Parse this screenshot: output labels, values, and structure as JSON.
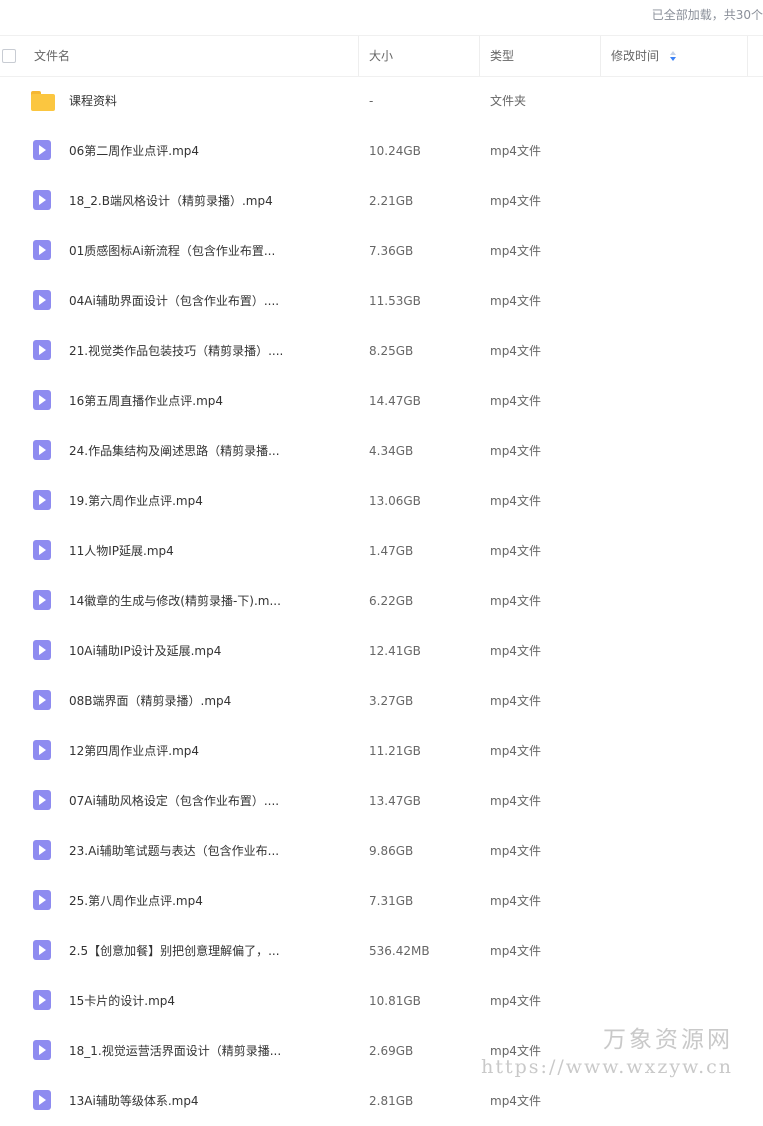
{
  "status": "已全部加载，共30个",
  "header": {
    "name": "文件名",
    "size": "大小",
    "type": "类型",
    "mtime": "修改时间"
  },
  "rows": [
    {
      "icon": "folder-icon",
      "name": "课程资料",
      "size": "-",
      "type": "文件夹"
    },
    {
      "icon": "video-icon",
      "name": "06第二周作业点评.mp4",
      "size": "10.24GB",
      "type": "mp4文件"
    },
    {
      "icon": "video-icon",
      "name": "18_2.B端风格设计（精剪录播）.mp4",
      "size": "2.21GB",
      "type": "mp4文件"
    },
    {
      "icon": "video-icon",
      "name": "01质感图标Ai新流程（包含作业布置...",
      "size": "7.36GB",
      "type": "mp4文件"
    },
    {
      "icon": "video-icon",
      "name": "04Ai辅助界面设计（包含作业布置）....",
      "size": "11.53GB",
      "type": "mp4文件"
    },
    {
      "icon": "video-icon",
      "name": "21.视觉类作品包装技巧（精剪录播）....",
      "size": "8.25GB",
      "type": "mp4文件"
    },
    {
      "icon": "video-icon",
      "name": "16第五周直播作业点评.mp4",
      "size": "14.47GB",
      "type": "mp4文件"
    },
    {
      "icon": "video-icon",
      "name": "24.作品集结构及阐述思路（精剪录播...",
      "size": "4.34GB",
      "type": "mp4文件"
    },
    {
      "icon": "video-icon",
      "name": "19.第六周作业点评.mp4",
      "size": "13.06GB",
      "type": "mp4文件"
    },
    {
      "icon": "video-icon",
      "name": "11人物IP延展.mp4",
      "size": "1.47GB",
      "type": "mp4文件"
    },
    {
      "icon": "video-icon",
      "name": "14徽章的生成与修改(精剪录播-下).m...",
      "size": "6.22GB",
      "type": "mp4文件"
    },
    {
      "icon": "video-icon",
      "name": "10Ai辅助IP设计及延展.mp4",
      "size": "12.41GB",
      "type": "mp4文件"
    },
    {
      "icon": "video-icon",
      "name": "08B端界面（精剪录播）.mp4",
      "size": "3.27GB",
      "type": "mp4文件"
    },
    {
      "icon": "video-icon",
      "name": "12第四周作业点评.mp4",
      "size": "11.21GB",
      "type": "mp4文件"
    },
    {
      "icon": "video-icon",
      "name": "07Ai辅助风格设定（包含作业布置）....",
      "size": "13.47GB",
      "type": "mp4文件"
    },
    {
      "icon": "video-icon",
      "name": "23.Ai辅助笔试题与表达（包含作业布...",
      "size": "9.86GB",
      "type": "mp4文件"
    },
    {
      "icon": "video-icon",
      "name": "25.第八周作业点评.mp4",
      "size": "7.31GB",
      "type": "mp4文件"
    },
    {
      "icon": "video-icon",
      "name": "2.5【创意加餐】别把创意理解偏了，...",
      "size": "536.42MB",
      "type": "mp4文件"
    },
    {
      "icon": "video-icon",
      "name": "15卡片的设计.mp4",
      "size": "10.81GB",
      "type": "mp4文件"
    },
    {
      "icon": "video-icon",
      "name": "18_1.视觉运营活界面设计（精剪录播...",
      "size": "2.69GB",
      "type": "mp4文件"
    },
    {
      "icon": "video-icon",
      "name": "13Ai辅助等级体系.mp4",
      "size": "2.81GB",
      "type": "mp4文件"
    }
  ],
  "watermark": {
    "line1": "万象资源网",
    "line2": "https://www.wxzyw.cn"
  }
}
